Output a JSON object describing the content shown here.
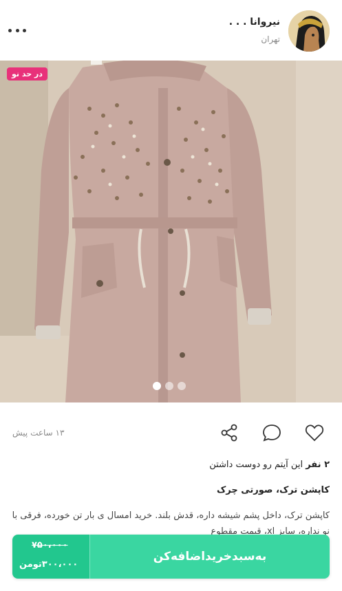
{
  "header": {
    "username": "نیروانا . . .",
    "city": "تهران"
  },
  "photo": {
    "badge": "در حد نو",
    "slide_count": 3,
    "active_slide": 1
  },
  "meta": {
    "posted": "۱۳ ساعت پیش"
  },
  "likes": {
    "count": "۲ نفر",
    "text": " این آیتم رو دوست داشتن"
  },
  "product": {
    "title": "کاپشن ترک، صورتی چرک",
    "description": "کاپشن ترک، داخل پشم شیشه داره، قدش بلند. خرید امسال ی بار تن خورده، فرقی با نو نداره، سایز xl، قیمت مقطوع"
  },
  "purchase": {
    "old_price": "۷۵۰،۰۰۰",
    "new_price": "۳۰۰،۰۰۰",
    "currency": "تومن",
    "add_to_cart": "به‌سبدخرید‌اضافه‌کن"
  },
  "icons": {
    "more": "more-dots-icon",
    "share": "share-icon",
    "comment": "comment-icon",
    "like": "heart-icon"
  },
  "colors": {
    "accent_green": "#3ad6a1",
    "price_green": "#22c78e",
    "badge_pink": "#e8317a"
  }
}
